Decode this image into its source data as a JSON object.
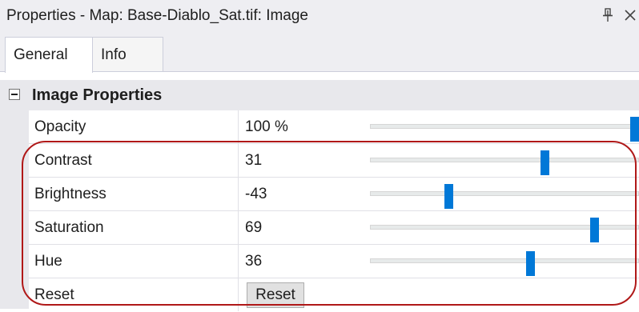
{
  "window": {
    "title": "Properties - Map: Base-Diablo_Sat.tif: Image"
  },
  "tabs": [
    {
      "label": "General",
      "active": true
    },
    {
      "label": "Info",
      "active": false
    }
  ],
  "section": {
    "title": "Image Properties"
  },
  "properties": [
    {
      "label": "Opacity",
      "value": "100 %",
      "slider_fraction": 1.0
    },
    {
      "label": "Contrast",
      "value": "31",
      "slider_fraction": 0.655
    },
    {
      "label": "Brightness",
      "value": "-43",
      "slider_fraction": 0.285
    },
    {
      "label": "Saturation",
      "value": "69",
      "slider_fraction": 0.845
    },
    {
      "label": "Hue",
      "value": "36",
      "slider_fraction": 0.6
    },
    {
      "label": "Reset",
      "button_label": "Reset"
    }
  ],
  "colors": {
    "accent": "#0078d7",
    "highlight": "#b01818"
  }
}
